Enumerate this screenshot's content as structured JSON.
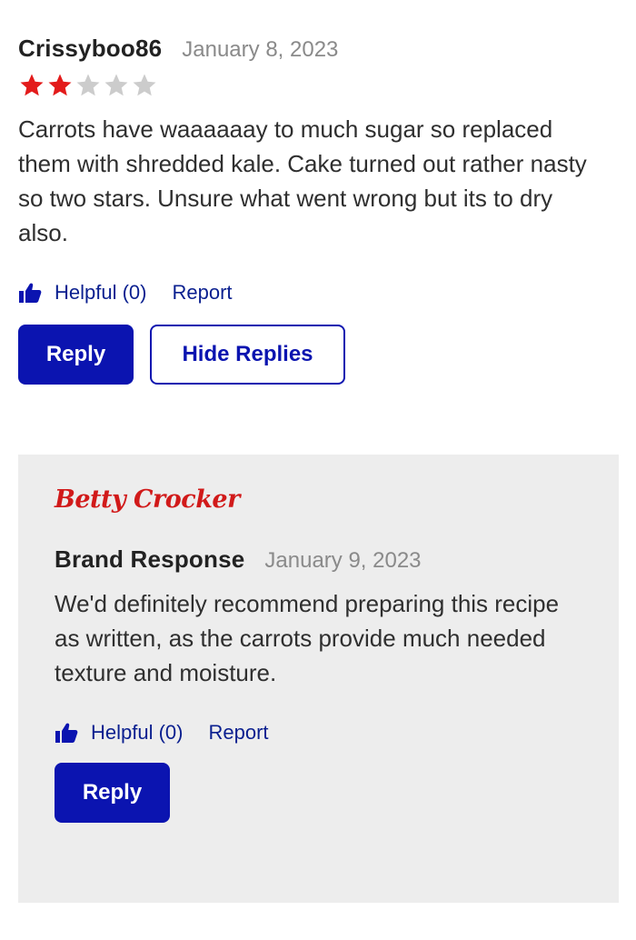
{
  "review": {
    "author": "Crissyboo86",
    "date": "January 8, 2023",
    "rating": 2,
    "max_rating": 5,
    "star_filled_color": "#e31b1b",
    "star_empty_color": "#cccccc",
    "body": "Carrots have waaaaaay to much sugar so replaced them with shredded kale. Cake turned out rather nasty so two stars. Unsure what went wrong but its to dry also.",
    "helpful_label": "Helpful (0)",
    "report_label": "Report",
    "reply_label": "Reply",
    "hide_replies_label": "Hide Replies"
  },
  "response": {
    "brand_logo_text": "Betty Crocker",
    "author": "Brand Response",
    "date": "January 9, 2023",
    "body": "We'd definitely recommend preparing this recipe as written, as the carrots provide much needed texture and moisture.",
    "helpful_label": "Helpful (0)",
    "report_label": "Report",
    "reply_label": "Reply"
  },
  "colors": {
    "accent": "#0b14b0",
    "link": "#0a1f8f",
    "brand_red": "#d11a1a",
    "response_bg": "#ededed"
  },
  "icons": {
    "helpful": "thumbs-up-icon",
    "star": "star-icon"
  }
}
